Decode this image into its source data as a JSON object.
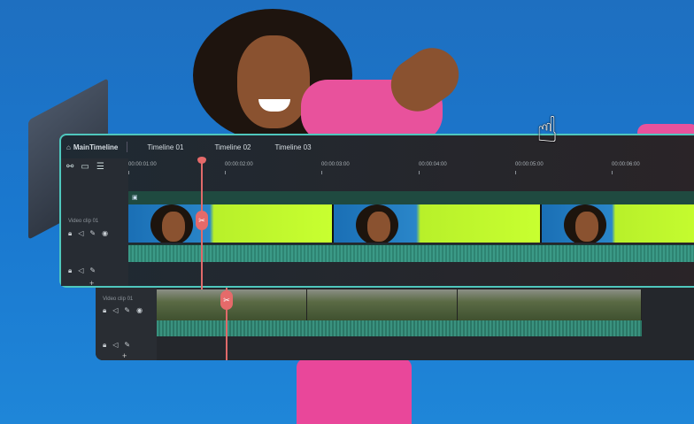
{
  "timeline": {
    "tabs": [
      "MainTimeline",
      "Timeline 01",
      "Timeline 02",
      "Timeline 03"
    ],
    "ruler": [
      "00:00:01:00",
      "00:00:02:00",
      "00:00:03:00",
      "00:00:04:00",
      "00:00:05:00",
      "00:00:06:00"
    ],
    "track1_label": "Video clip 01",
    "track2_label": "Video clip 01"
  },
  "colors": {
    "accent": "#4fc7bd",
    "playhead": "#e06a6a",
    "background": "#1a78cf"
  }
}
